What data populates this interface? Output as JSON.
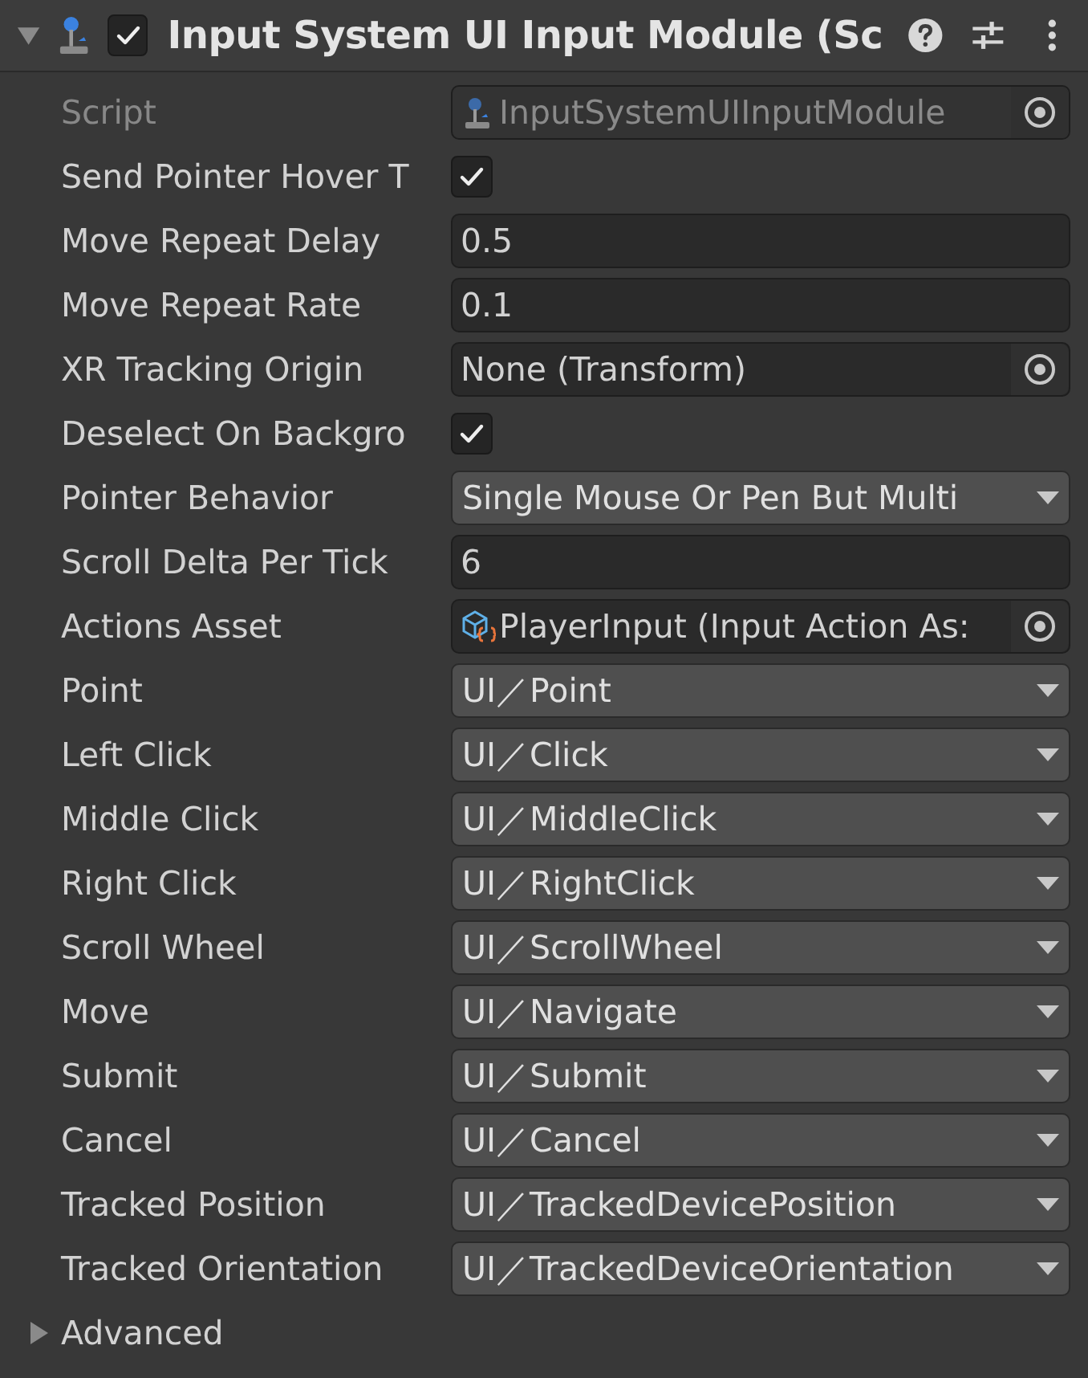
{
  "component": {
    "title": "Input System UI Input Module (Sc",
    "expanded": true,
    "enabled": true
  },
  "properties": [
    {
      "label": "Script",
      "kind": "script",
      "value": "InputSystemUIInputModule",
      "disabled": true
    },
    {
      "label": "Send Pointer Hover T",
      "kind": "checkbox",
      "checked": true
    },
    {
      "label": "Move Repeat Delay",
      "kind": "text",
      "value": "0.5"
    },
    {
      "label": "Move Repeat Rate",
      "kind": "text",
      "value": "0.1"
    },
    {
      "label": "XR Tracking Origin",
      "kind": "object",
      "value": "None (Transform)",
      "disabled": false
    },
    {
      "label": "Deselect On Backgro",
      "kind": "checkbox",
      "checked": true
    },
    {
      "label": "Pointer Behavior",
      "kind": "dropdown",
      "value": "Single Mouse Or Pen But Multi"
    },
    {
      "label": "Scroll Delta Per Tick",
      "kind": "text",
      "value": "6"
    },
    {
      "label": "Actions Asset",
      "kind": "asset",
      "value": "PlayerInput (Input Action As:",
      "disabled": false
    },
    {
      "label": "Point",
      "kind": "dropdown",
      "value": "UI／Point"
    },
    {
      "label": "Left Click",
      "kind": "dropdown",
      "value": "UI／Click"
    },
    {
      "label": "Middle Click",
      "kind": "dropdown",
      "value": "UI／MiddleClick"
    },
    {
      "label": "Right Click",
      "kind": "dropdown",
      "value": "UI／RightClick"
    },
    {
      "label": "Scroll Wheel",
      "kind": "dropdown",
      "value": "UI／ScrollWheel"
    },
    {
      "label": "Move",
      "kind": "dropdown",
      "value": "UI／Navigate"
    },
    {
      "label": "Submit",
      "kind": "dropdown",
      "value": "UI／Submit"
    },
    {
      "label": "Cancel",
      "kind": "dropdown",
      "value": "UI／Cancel"
    },
    {
      "label": "Tracked Position",
      "kind": "dropdown",
      "value": "UI／TrackedDevicePosition"
    },
    {
      "label": "Tracked Orientation",
      "kind": "dropdown",
      "value": "UI／TrackedDeviceOrientation"
    }
  ],
  "foldouts": [
    {
      "label": "Advanced",
      "expanded": false
    }
  ]
}
